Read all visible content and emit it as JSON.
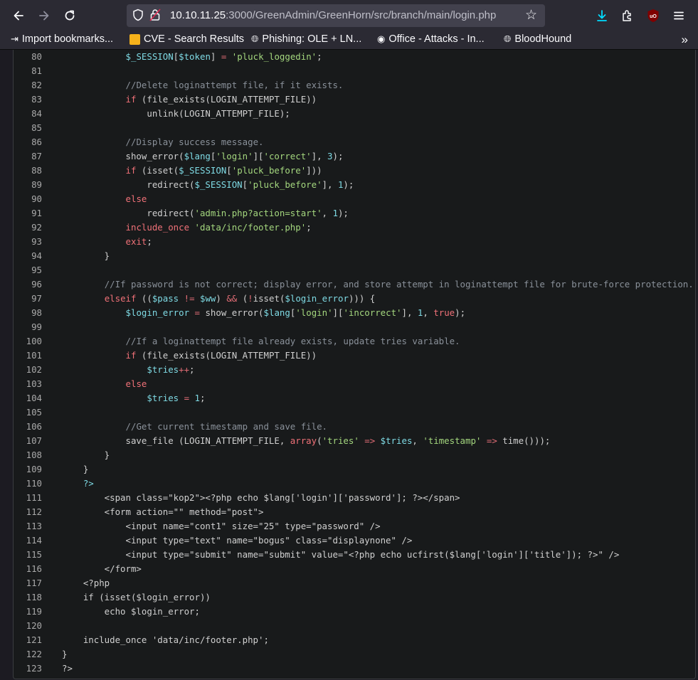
{
  "browser": {
    "url_host": "10.10.11.25",
    "url_rest": ":3000/GreenAdmin/GreenHorn/src/branch/main/login.php",
    "back_label": "←",
    "forward_label": "→",
    "reload_label": "↻",
    "bookmarks": [
      {
        "label": "Import bookmarks...",
        "icon": "import-icon"
      },
      {
        "label": "CVE - Search Results",
        "icon": "folder-icon"
      },
      {
        "label": "Phishing: OLE + LN...",
        "icon": "globe-icon"
      },
      {
        "label": "Office - Attacks - In...",
        "icon": "ghost-icon"
      },
      {
        "label": "BloodHound",
        "icon": "globe-icon"
      }
    ]
  },
  "code_lines": [
    {
      "n": "80",
      "toks": [
        [
          "pl",
          "            "
        ],
        [
          "var",
          "$_SESSION"
        ],
        [
          "pl",
          "["
        ],
        [
          "var",
          "$token"
        ],
        [
          "pl",
          "] "
        ],
        [
          "op",
          "="
        ],
        [
          "pl",
          " "
        ],
        [
          "str",
          "'pluck_loggedin'"
        ],
        [
          "pl",
          ";"
        ]
      ]
    },
    {
      "n": "81",
      "toks": []
    },
    {
      "n": "82",
      "toks": [
        [
          "pl",
          "            "
        ],
        [
          "com",
          "//Delete loginattempt file, if it exists."
        ]
      ]
    },
    {
      "n": "83",
      "toks": [
        [
          "pl",
          "            "
        ],
        [
          "kw",
          "if"
        ],
        [
          "pl",
          " (file_exists(LOGIN_ATTEMPT_FILE))"
        ]
      ]
    },
    {
      "n": "84",
      "toks": [
        [
          "pl",
          "                unlink(LOGIN_ATTEMPT_FILE);"
        ]
      ]
    },
    {
      "n": "85",
      "toks": []
    },
    {
      "n": "86",
      "toks": [
        [
          "pl",
          "            "
        ],
        [
          "com",
          "//Display success message."
        ]
      ]
    },
    {
      "n": "87",
      "toks": [
        [
          "pl",
          "            show_error("
        ],
        [
          "var",
          "$lang"
        ],
        [
          "pl",
          "["
        ],
        [
          "str",
          "'login'"
        ],
        [
          "pl",
          "]["
        ],
        [
          "str",
          "'correct'"
        ],
        [
          "pl",
          "], "
        ],
        [
          "num",
          "3"
        ],
        [
          "pl",
          ");"
        ]
      ]
    },
    {
      "n": "88",
      "toks": [
        [
          "pl",
          "            "
        ],
        [
          "kw",
          "if"
        ],
        [
          "pl",
          " (isset("
        ],
        [
          "var",
          "$_SESSION"
        ],
        [
          "pl",
          "["
        ],
        [
          "str",
          "'pluck_before'"
        ],
        [
          "pl",
          "]))"
        ]
      ]
    },
    {
      "n": "89",
      "toks": [
        [
          "pl",
          "                redirect("
        ],
        [
          "var",
          "$_SESSION"
        ],
        [
          "pl",
          "["
        ],
        [
          "str",
          "'pluck_before'"
        ],
        [
          "pl",
          "], "
        ],
        [
          "num",
          "1"
        ],
        [
          "pl",
          ");"
        ]
      ]
    },
    {
      "n": "90",
      "toks": [
        [
          "pl",
          "            "
        ],
        [
          "kw",
          "else"
        ]
      ]
    },
    {
      "n": "91",
      "toks": [
        [
          "pl",
          "                redirect("
        ],
        [
          "str",
          "'admin.php?action=start'"
        ],
        [
          "pl",
          ", "
        ],
        [
          "num",
          "1"
        ],
        [
          "pl",
          ");"
        ]
      ]
    },
    {
      "n": "92",
      "toks": [
        [
          "pl",
          "            "
        ],
        [
          "kw",
          "include_once"
        ],
        [
          "pl",
          " "
        ],
        [
          "str",
          "'data/inc/footer.php'"
        ],
        [
          "pl",
          ";"
        ]
      ]
    },
    {
      "n": "93",
      "toks": [
        [
          "pl",
          "            "
        ],
        [
          "kw",
          "exit"
        ],
        [
          "pl",
          ";"
        ]
      ]
    },
    {
      "n": "94",
      "toks": [
        [
          "pl",
          "        }"
        ]
      ]
    },
    {
      "n": "95",
      "toks": []
    },
    {
      "n": "96",
      "toks": [
        [
          "pl",
          "        "
        ],
        [
          "com",
          "//If password is not correct; display error, and store attempt in loginattempt file for brute-force protection."
        ]
      ]
    },
    {
      "n": "97",
      "toks": [
        [
          "pl",
          "        "
        ],
        [
          "kw",
          "elseif"
        ],
        [
          "pl",
          " (("
        ],
        [
          "var",
          "$pass"
        ],
        [
          "pl",
          " "
        ],
        [
          "op",
          "!="
        ],
        [
          "pl",
          " "
        ],
        [
          "var",
          "$ww"
        ],
        [
          "pl",
          ") "
        ],
        [
          "op",
          "&&"
        ],
        [
          "pl",
          " ("
        ],
        [
          "op",
          "!"
        ],
        [
          "pl",
          "isset("
        ],
        [
          "var",
          "$login_error"
        ],
        [
          "pl",
          "))) {"
        ]
      ]
    },
    {
      "n": "98",
      "toks": [
        [
          "pl",
          "            "
        ],
        [
          "var",
          "$login_error"
        ],
        [
          "pl",
          " "
        ],
        [
          "op",
          "="
        ],
        [
          "pl",
          " show_error("
        ],
        [
          "var",
          "$lang"
        ],
        [
          "pl",
          "["
        ],
        [
          "str",
          "'login'"
        ],
        [
          "pl",
          "]["
        ],
        [
          "str",
          "'incorrect'"
        ],
        [
          "pl",
          "], "
        ],
        [
          "num",
          "1"
        ],
        [
          "pl",
          ", "
        ],
        [
          "kw",
          "true"
        ],
        [
          "pl",
          ");"
        ]
      ]
    },
    {
      "n": "99",
      "toks": []
    },
    {
      "n": "100",
      "toks": [
        [
          "pl",
          "            "
        ],
        [
          "com",
          "//If a loginattempt file already exists, update tries variable."
        ]
      ]
    },
    {
      "n": "101",
      "toks": [
        [
          "pl",
          "            "
        ],
        [
          "kw",
          "if"
        ],
        [
          "pl",
          " (file_exists(LOGIN_ATTEMPT_FILE))"
        ]
      ]
    },
    {
      "n": "102",
      "toks": [
        [
          "pl",
          "                "
        ],
        [
          "var",
          "$tries"
        ],
        [
          "op",
          "++"
        ],
        [
          "pl",
          ";"
        ]
      ]
    },
    {
      "n": "103",
      "toks": [
        [
          "pl",
          "            "
        ],
        [
          "kw",
          "else"
        ]
      ]
    },
    {
      "n": "104",
      "toks": [
        [
          "pl",
          "                "
        ],
        [
          "var",
          "$tries"
        ],
        [
          "pl",
          " "
        ],
        [
          "op",
          "="
        ],
        [
          "pl",
          " "
        ],
        [
          "num",
          "1"
        ],
        [
          "pl",
          ";"
        ]
      ]
    },
    {
      "n": "105",
      "toks": []
    },
    {
      "n": "106",
      "toks": [
        [
          "pl",
          "            "
        ],
        [
          "com",
          "//Get current timestamp and save file."
        ]
      ]
    },
    {
      "n": "107",
      "toks": [
        [
          "pl",
          "            save_file (LOGIN_ATTEMPT_FILE, "
        ],
        [
          "kw",
          "array"
        ],
        [
          "pl",
          "("
        ],
        [
          "str",
          "'tries'"
        ],
        [
          "pl",
          " "
        ],
        [
          "op",
          "=>"
        ],
        [
          "pl",
          " "
        ],
        [
          "var",
          "$tries"
        ],
        [
          "pl",
          ", "
        ],
        [
          "str",
          "'timestamp'"
        ],
        [
          "pl",
          " "
        ],
        [
          "op",
          "=>"
        ],
        [
          "pl",
          " time()));"
        ]
      ]
    },
    {
      "n": "108",
      "toks": [
        [
          "pl",
          "        }"
        ]
      ]
    },
    {
      "n": "109",
      "toks": [
        [
          "pl",
          "    }"
        ]
      ]
    },
    {
      "n": "110",
      "toks": [
        [
          "pl",
          "    "
        ],
        [
          "var",
          "?>"
        ]
      ]
    },
    {
      "n": "111",
      "toks": [
        [
          "pl",
          "        <span class=\"kop2\"><?php echo $lang['login']['password']; ?></span>"
        ]
      ]
    },
    {
      "n": "112",
      "toks": [
        [
          "pl",
          "        <form action=\"\" method=\"post\">"
        ]
      ]
    },
    {
      "n": "113",
      "toks": [
        [
          "pl",
          "            <input name=\"cont1\" size=\"25\" type=\"password\" />"
        ]
      ]
    },
    {
      "n": "114",
      "toks": [
        [
          "pl",
          "            <input type=\"text\" name=\"bogus\" class=\"displaynone\" />"
        ]
      ]
    },
    {
      "n": "115",
      "toks": [
        [
          "pl",
          "            <input type=\"submit\" name=\"submit\" value=\"<?php echo ucfirst($lang['login']['title']); ?>\" />"
        ]
      ]
    },
    {
      "n": "116",
      "toks": [
        [
          "pl",
          "        </form>"
        ]
      ]
    },
    {
      "n": "117",
      "toks": [
        [
          "pl",
          "    <?php"
        ]
      ]
    },
    {
      "n": "118",
      "toks": [
        [
          "pl",
          "    if (isset($login_error))"
        ]
      ]
    },
    {
      "n": "119",
      "toks": [
        [
          "pl",
          "        echo $login_error;"
        ]
      ]
    },
    {
      "n": "120",
      "toks": []
    },
    {
      "n": "121",
      "toks": [
        [
          "pl",
          "    include_once 'data/inc/footer.php';"
        ]
      ]
    },
    {
      "n": "122",
      "toks": [
        [
          "pl",
          "}"
        ]
      ]
    },
    {
      "n": "123",
      "toks": [
        [
          "pl",
          "?>"
        ]
      ]
    }
  ]
}
